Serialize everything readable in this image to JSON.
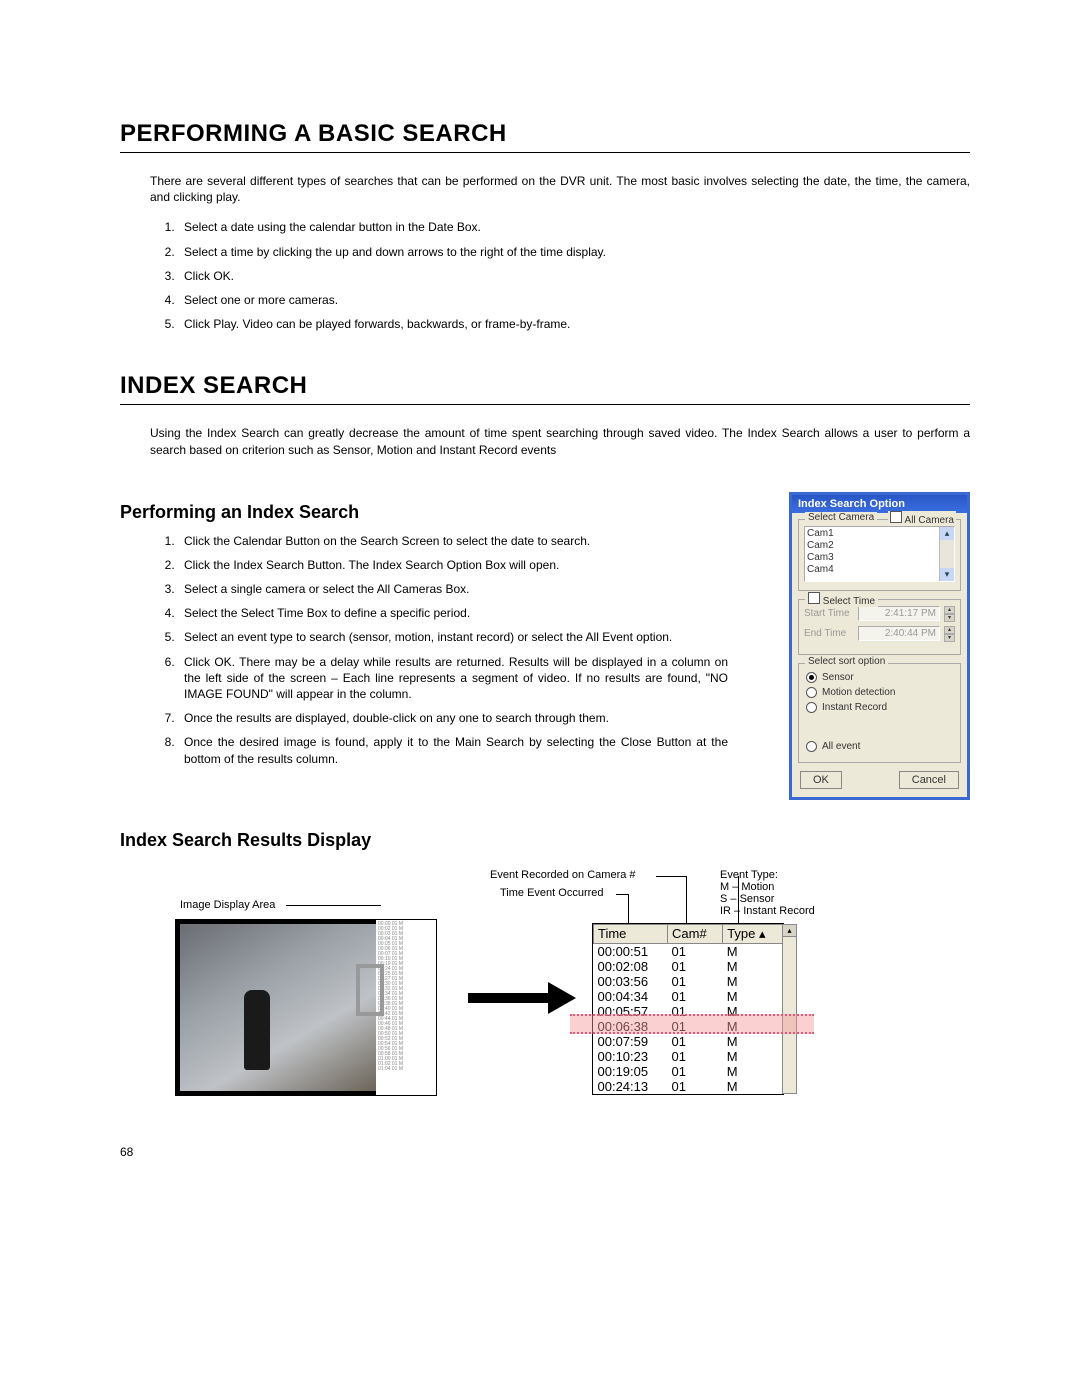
{
  "sections": {
    "basic_search": {
      "title": "PERFORMING A BASIC SEARCH",
      "intro": "There are several different types of searches that can be performed on the DVR unit. The most basic involves selecting the date, the time, the camera, and clicking play.",
      "steps": [
        "Select a date using the calendar button in the Date Box.",
        "Select a time by clicking the up and down arrows to the right of the time display.",
        "Click OK.",
        "Select one or more cameras.",
        "Click Play.  Video can be played forwards, backwards, or frame-by-frame."
      ]
    },
    "index_search": {
      "title": "INDEX SEARCH",
      "intro": "Using the Index Search can greatly decrease the amount of time spent searching through saved video. The Index Search allows a user to perform a search based on criterion such as Sensor, Motion and Instant Record events"
    },
    "performing_index": {
      "title": "Performing an Index Search",
      "steps": [
        "Click the Calendar Button on the Search Screen to select the date to search.",
        "Click the Index Search Button.  The Index Search Option Box will open.",
        "Select a single camera or select the All Cameras Box.",
        "Select the Select Time Box to define a specific period.",
        "Select an event type to search (sensor, motion, instant record) or select the All Event option.",
        "Click OK.  There may be a delay while results are returned.  Results will be displayed in a column on the left side of the screen – Each line represents a segment of video.  If no results are found, \"NO IMAGE FOUND\" will appear in the column.",
        "Once the results are displayed, double-click on any one to search through them.",
        "Once the desired image is found, apply it to the Main Search by selecting the Close Button at the bottom of the results column."
      ]
    },
    "results_display": {
      "title": "Index Search Results Display"
    }
  },
  "dialog": {
    "title": "Index Search Option",
    "select_camera_label": "Select Camera",
    "all_camera_label": "All Camera",
    "cameras": [
      "Cam1",
      "Cam2",
      "Cam3",
      "Cam4"
    ],
    "select_time_label": "Select Time",
    "start_time_label": "Start Time",
    "start_time_value": "2:41:17 PM",
    "end_time_label": "End Time",
    "end_time_value": "2:40:44 PM",
    "sort_label": "Select sort option",
    "sort_options": [
      "Sensor",
      "Motion detection",
      "Instant Record"
    ],
    "sort_selected_index": 0,
    "all_event_label": "All event",
    "ok_label": "OK",
    "cancel_label": "Cancel"
  },
  "figure": {
    "anno_image_display": "Image Display Area",
    "anno_event_camera": "Event Recorded on Camera #",
    "anno_time_occurred": "Time Event Occurred",
    "anno_event_type_title": "Event Type:",
    "anno_event_type_lines": [
      "M – Motion",
      "S – Sensor",
      "IR – Instant Record"
    ],
    "table_headers": [
      "Time",
      "Cam#",
      "Type"
    ],
    "rows": [
      {
        "time": "00:00:51",
        "cam": "01",
        "type": "M"
      },
      {
        "time": "00:02:08",
        "cam": "01",
        "type": "M"
      },
      {
        "time": "00:03:56",
        "cam": "01",
        "type": "M"
      },
      {
        "time": "00:04:34",
        "cam": "01",
        "type": "M"
      },
      {
        "time": "00:05:57",
        "cam": "01",
        "type": "M"
      },
      {
        "time": "00:06:38",
        "cam": "01",
        "type": "M"
      },
      {
        "time": "00:07:59",
        "cam": "01",
        "type": "M"
      },
      {
        "time": "00:10:23",
        "cam": "01",
        "type": "M"
      },
      {
        "time": "00:19:05",
        "cam": "01",
        "type": "M"
      },
      {
        "time": "00:24:13",
        "cam": "01",
        "type": "M"
      }
    ],
    "highlight_index": 5
  },
  "page_number": "68"
}
